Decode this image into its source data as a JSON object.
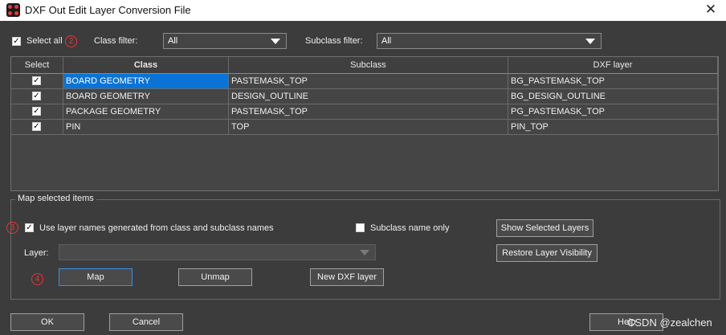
{
  "window": {
    "title": "DXF Out Edit Layer Conversion File",
    "close_glyph": "✕",
    "app_icon": "allegro-app-icon"
  },
  "filters": {
    "select_all_label": "Select all",
    "select_all_checked": true,
    "class_filter_label": "Class filter:",
    "class_filter_value": "All",
    "subclass_filter_label": "Subclass filter:",
    "subclass_filter_value": "All"
  },
  "markers": {
    "m2": "2",
    "m3": "3",
    "m4": "4"
  },
  "table": {
    "columns": [
      "Select",
      "Class",
      "Subclass",
      "DXF layer"
    ],
    "rows": [
      {
        "checked": true,
        "class": "BOARD GEOMETRY",
        "subclass": "PASTEMASK_TOP",
        "dxf_layer": "BG_PASTEMASK_TOP"
      },
      {
        "checked": true,
        "class": "BOARD GEOMETRY",
        "subclass": "DESIGN_OUTLINE",
        "dxf_layer": "BG_DESIGN_OUTLINE"
      },
      {
        "checked": true,
        "class": "PACKAGE GEOMETRY",
        "subclass": "PASTEMASK_TOP",
        "dxf_layer": "PG_PASTEMASK_TOP"
      },
      {
        "checked": true,
        "class": "PIN",
        "subclass": "TOP",
        "dxf_layer": "PIN_TOP"
      }
    ]
  },
  "map_group": {
    "title": "Map selected items",
    "use_layer_names_label": "Use layer names generated from class and subclass names",
    "use_layer_names_checked": true,
    "subclass_only_label": "Subclass name only",
    "subclass_only_checked": false,
    "layer_label": "Layer:",
    "layer_value": "",
    "show_selected_layers": "Show Selected Layers",
    "restore_visibility": "Restore Layer Visibility",
    "map": "Map",
    "unmap": "Unmap",
    "new_dxf_layer": "New DXF layer"
  },
  "footer": {
    "ok": "OK",
    "cancel": "Cancel",
    "help": "Help",
    "watermark": "CSDN @zealchen"
  },
  "colors": {
    "selection": "#0a74d6",
    "marker": "#e33333",
    "background": "#3c3c3c"
  }
}
